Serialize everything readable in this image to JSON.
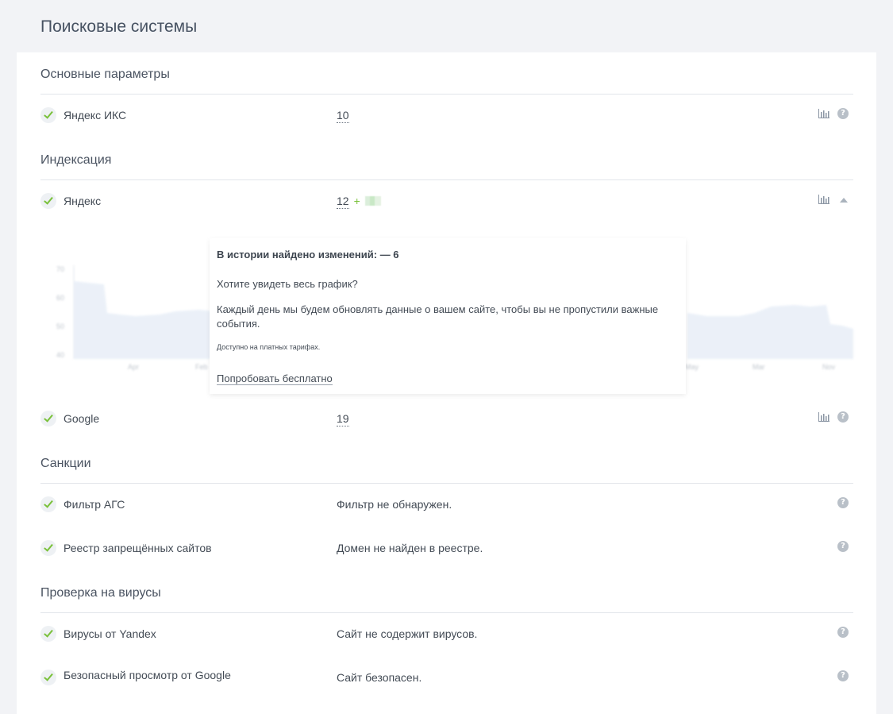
{
  "page_title": "Поисковые системы",
  "sections": {
    "main": {
      "title": "Основные параметры",
      "rows": [
        {
          "label": "Яндекс ИКС",
          "value": "10"
        }
      ]
    },
    "indexing": {
      "title": "Индексация",
      "rows": [
        {
          "label": "Яндекс",
          "value": "12",
          "plus": "+"
        },
        {
          "label": "Google",
          "value": "19"
        }
      ],
      "chart": {
        "y_ticks": [
          "70",
          "60",
          "50",
          "40"
        ],
        "x_ticks": [
          "Apr",
          "Feb",
          "May",
          "Mar",
          "Nov"
        ]
      }
    },
    "sanctions": {
      "title": "Санкции",
      "rows": [
        {
          "label": "Фильтр АГС",
          "value": "Фильтр не обнаружен."
        },
        {
          "label": "Реестр запрещённых сайтов",
          "value": "Домен не найден в реестре."
        }
      ]
    },
    "viruses": {
      "title": "Проверка на вирусы",
      "rows": [
        {
          "label": "Вирусы от Yandex",
          "value": "Сайт не содержит вирусов."
        },
        {
          "label": "Безопасный просмотр от Google",
          "value": "Сайт безопасен."
        }
      ]
    }
  },
  "popup": {
    "title": "В истории найдено изменений: — 6",
    "question": "Хотите увидеть весь график?",
    "body": "Каждый день мы будем обновлять данные о вашем сайте, чтобы вы не пропустили важные события.",
    "note": "Доступно на платных тарифах.",
    "cta": "Попробовать бесплатно"
  },
  "icons": {
    "check": "check-icon",
    "chart": "bar-chart-icon",
    "help": "question-icon",
    "collapse": "collapse-up-icon",
    "help_glyph": "?"
  },
  "colors": {
    "accent_green": "#7ac13b",
    "background": "#f2f3f6",
    "chart_fill": "#e8eef8"
  }
}
